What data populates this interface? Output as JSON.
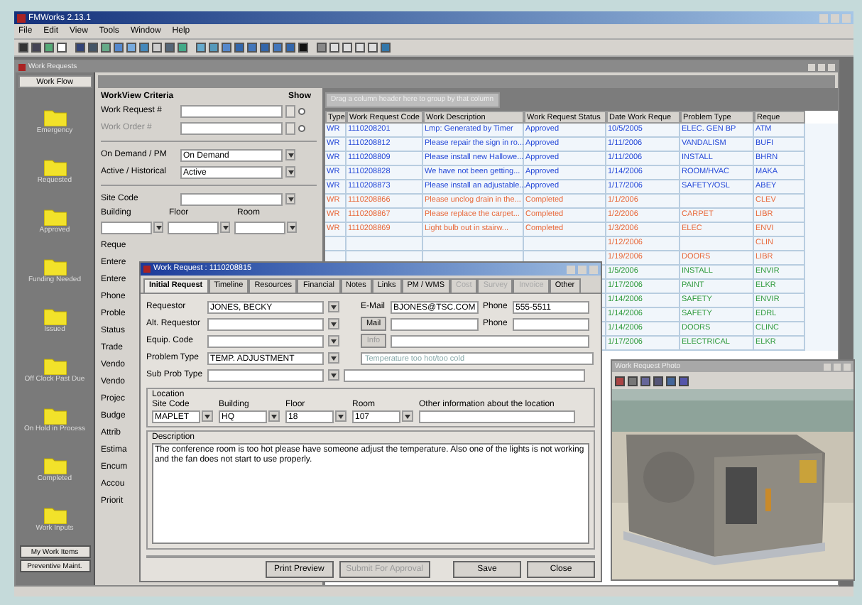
{
  "window": {
    "title": "FMWorks 2.13.1"
  },
  "menu": [
    "File",
    "Edit",
    "View",
    "Tools",
    "Window",
    "Help"
  ],
  "child_window": {
    "title": "Work Requests"
  },
  "sidebar": {
    "header": "Work Flow",
    "items": [
      {
        "label": "Emergency",
        "selected": false
      },
      {
        "label": "Requested",
        "selected": false
      },
      {
        "label": "Approved",
        "selected": false
      },
      {
        "label": "Funding Needed",
        "selected": false
      },
      {
        "label": "Issued",
        "selected": false
      },
      {
        "label": "Off Clock Past Due",
        "selected": false
      },
      {
        "label": "On Hold in Process",
        "selected": false
      },
      {
        "label": "Completed",
        "selected": false
      },
      {
        "label": "Work Inputs",
        "selected": false
      }
    ],
    "buttons": [
      "My Work Items",
      "Preventive Maint."
    ]
  },
  "criteria": {
    "title": "WorkView Criteria",
    "show_label": "Show",
    "fields": [
      {
        "label": "Work Request #"
      },
      {
        "label": "Work Order #"
      }
    ],
    "selects": [
      {
        "label": "On Demand / PM",
        "value": "On Demand"
      },
      {
        "label": "Active / Historical",
        "value": "Active"
      }
    ],
    "site_code_label": "Site Code",
    "location_labels": [
      "Building",
      "Floor",
      "Room"
    ],
    "more_labels": [
      "Reque",
      "Entere",
      "Entere",
      "Phone",
      "Proble",
      "Status",
      "Trade",
      "Vendo",
      "Vendo",
      "Projec",
      "Budge",
      "Attrib",
      "Estima",
      "Encum",
      "Accou",
      "Priorit"
    ]
  },
  "grid": {
    "group_hint": "Drag a column header here to group by that column",
    "columns": [
      "Type",
      "Work Request Code",
      "Work Description",
      "Work Request Status",
      "Date Work Reque",
      "Problem Type",
      "Reque"
    ],
    "rows": [
      {
        "color": "#2448d8",
        "cells": [
          "WR",
          "1110208201",
          "Lmp: Generated by Timer",
          "Approved",
          "10/5/2005",
          "ELEC. GEN BP",
          "ATM"
        ]
      },
      {
        "color": "#2448d8",
        "cells": [
          "WR",
          "1110208812",
          "Please repair the sign in ro...",
          "Approved",
          "1/11/2006",
          "VANDALISM",
          "BUFI"
        ]
      },
      {
        "color": "#2448d8",
        "cells": [
          "WR",
          "1110208809",
          "Please install new Hallowe...",
          "Approved",
          "1/11/2006",
          "INSTALL",
          "BHRN"
        ]
      },
      {
        "color": "#2448d8",
        "cells": [
          "WR",
          "1110208828",
          "We have not been getting...",
          "Approved",
          "1/14/2006",
          "ROOM/HVAC",
          "MAKA"
        ]
      },
      {
        "color": "#2448d8",
        "cells": [
          "WR",
          "1110208873",
          "Please install an adjustable...",
          "Approved",
          "1/17/2006",
          "SAFETY/OSL",
          "ABEY"
        ]
      },
      {
        "color": "#e8683a",
        "cells": [
          "WR",
          "1110208866",
          "Please unclog drain in the...",
          "Completed",
          "1/1/2006",
          "",
          "CLEV"
        ]
      },
      {
        "color": "#e8683a",
        "cells": [
          "WR",
          "1110208867",
          "Please replace the carpet...",
          "Completed",
          "1/2/2006",
          "CARPET",
          "LIBR"
        ]
      },
      {
        "color": "#e8683a",
        "cells": [
          "WR",
          "1110208869",
          "Light bulb out in stairw...",
          "Completed",
          "1/3/2006",
          "ELEC",
          "ENVI"
        ]
      },
      {
        "color": "#e8683a",
        "cells": [
          "1/12/2006",
          "",
          "CLIN"
        ]
      },
      {
        "color": "#e8683a",
        "cells": [
          "1/19/2006",
          "DOORS",
          "LIBR"
        ]
      },
      {
        "color": "#2f9a3c",
        "cells": [
          "1/5/2006",
          "INSTALL",
          "ENVIR"
        ]
      },
      {
        "color": "#2f9a3c",
        "cells": [
          "1/17/2006",
          "PAINT",
          "ELKR"
        ]
      },
      {
        "color": "#2f9a3c",
        "cells": [
          "1/14/2006",
          "SAFETY",
          "ENVIR"
        ]
      },
      {
        "color": "#2f9a3c",
        "cells": [
          "1/14/2006",
          "SAFETY",
          "EDRL"
        ]
      },
      {
        "color": "#2f9a3c",
        "cells": [
          "1/14/2006",
          "DOORS",
          "CLINC"
        ]
      },
      {
        "color": "#2f9a3c",
        "cells": [
          "1/17/2006",
          "ELECTRICAL",
          "ELKR"
        ]
      }
    ]
  },
  "dialog": {
    "title": "Work Request : 1110208815",
    "tabs": [
      {
        "label": "Initial Request",
        "selected": true,
        "disabled": false
      },
      {
        "label": "Timeline",
        "selected": false,
        "disabled": false
      },
      {
        "label": "Resources",
        "selected": false,
        "disabled": false
      },
      {
        "label": "Financial",
        "selected": false,
        "disabled": false
      },
      {
        "label": "Notes",
        "selected": false,
        "disabled": false
      },
      {
        "label": "Links",
        "selected": false,
        "disabled": false
      },
      {
        "label": "PM / WMS",
        "selected": false,
        "disabled": false
      },
      {
        "label": "Cost",
        "selected": false,
        "disabled": true
      },
      {
        "label": "Survey",
        "selected": false,
        "disabled": true
      },
      {
        "label": "Invoice",
        "selected": false,
        "disabled": true
      },
      {
        "label": "Other",
        "selected": false,
        "disabled": false
      }
    ],
    "requestor": {
      "label": "Requestor",
      "value": "JONES, BECKY"
    },
    "email": {
      "label": "E-Mail",
      "value": "BJONES@TSC.COM"
    },
    "phone": {
      "label": "Phone",
      "value": "555-5511"
    },
    "alt_requestor": {
      "label": "Alt. Requestor"
    },
    "mail_button": "Mail",
    "alt_phone": {
      "label": "Phone"
    },
    "equip_code": {
      "label": "Equip. Code"
    },
    "info_button": "Info",
    "problem_type": {
      "label": "Problem Type",
      "value": "TEMP. ADJUSTMENT",
      "description": "Temperature too hot/too cold"
    },
    "sub_prob_type": {
      "label": "Sub Prob Type"
    },
    "location": {
      "title": "Location",
      "fields": [
        {
          "label": "Site Code",
          "value": "MAPLET"
        },
        {
          "label": "Building",
          "value": "HQ"
        },
        {
          "label": "Floor",
          "value": "18"
        },
        {
          "label": "Room",
          "value": "107"
        }
      ],
      "other_label": "Other information about the location"
    },
    "description": {
      "label": "Description",
      "value": "The conference room is too hot please have someone adjust the temperature. Also one of the lights is not working and the fan does not start to use properly."
    },
    "buttons": [
      {
        "label": "Print Preview",
        "disabled": false
      },
      {
        "label": "Submit For Approval",
        "disabled": true
      },
      {
        "label": "Save",
        "disabled": false
      },
      {
        "label": "Close",
        "disabled": false
      }
    ]
  },
  "photo_window": {
    "title": "Work Request Photo"
  }
}
